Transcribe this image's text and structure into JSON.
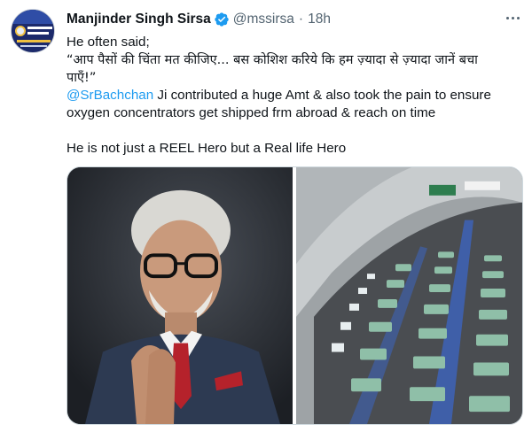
{
  "author": {
    "name": "Manjinder Singh Sirsa",
    "handle": "@mssirsa",
    "separator": "·",
    "time": "18h",
    "verified": true,
    "avatar_icon": "profile-avatar"
  },
  "tweet": {
    "line1": "He often said;",
    "line2": "“आप पैसों की चिंता मत कीजिए... बस कोशिश करिये कि हम ज़्यादा से ज़्यादा जानें बचा",
    "line3": "पाएँ!”",
    "mention": "@SrBachchan",
    "line4_rest": " Ji contributed a huge Amt & also took the pain to ensure",
    "line5": "oxygen concentrators get shipped frm abroad & reach on time",
    "line6": "He is not just a REEL Hero but a Real life Hero"
  },
  "media": {
    "count": 2,
    "icons": [
      "portrait-photo",
      "hospital-beds-photo"
    ]
  },
  "colors": {
    "text": "#0f1419",
    "secondary": "#536471",
    "link": "#1d9bf0",
    "verified": "#1d9bf0"
  }
}
